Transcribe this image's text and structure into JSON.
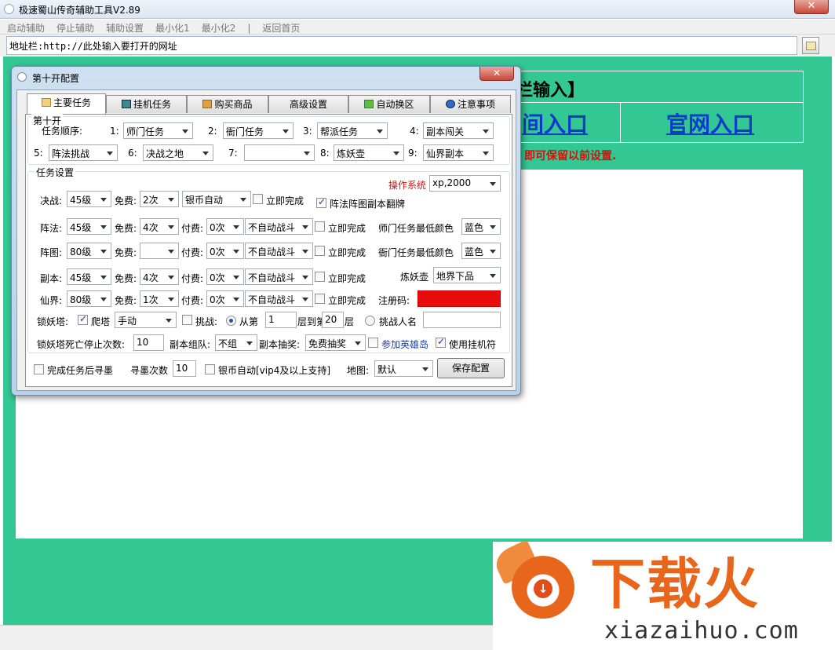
{
  "window": {
    "title": "极速蜀山传奇辅助工具V2.89",
    "close": "✕"
  },
  "menu": [
    "启动辅助",
    "停止辅助",
    "辅助设置",
    "最小化1",
    "最小化2",
    "|",
    "返回首页"
  ],
  "address": {
    "label": "地址栏:",
    "value": "http://此处输入要打开的网址"
  },
  "page": {
    "header_visible": "栏输入】",
    "link1": "间入口",
    "link2": "官网入口",
    "notice": "即可保留以前设置."
  },
  "watermark": {
    "text": "下载火",
    "url": "xiazaihuo.com"
  },
  "dialog": {
    "title": "第十开配置",
    "tabs": [
      "主要任务",
      "挂机任务",
      "购买商品",
      "高级设置",
      "自动换区",
      "注意事项"
    ],
    "group1": {
      "legend": "第十开",
      "order_label": "任务顺序:",
      "slots": [
        {
          "n": "1:",
          "v": "师门任务"
        },
        {
          "n": "2:",
          "v": "衙门任务"
        },
        {
          "n": "3:",
          "v": "帮派任务"
        },
        {
          "n": "4:",
          "v": "副本闯关"
        },
        {
          "n": "5:",
          "v": "阵法挑战"
        },
        {
          "n": "6:",
          "v": "决战之地"
        },
        {
          "n": "7:",
          "v": ""
        },
        {
          "n": "8:",
          "v": "炼妖壶"
        },
        {
          "n": "9:",
          "v": "仙界副本"
        }
      ]
    },
    "group2": {
      "legend": "任务设置",
      "os_label": "操作系统",
      "os_value": "xp,2000",
      "juezhan": {
        "label": "决战:",
        "level": "45级",
        "free_label": "免费:",
        "free": "2次",
        "mode": "银币自动",
        "instant": "立即完成"
      },
      "flip_label": "阵法阵图副本翻牌",
      "zhenfa": {
        "label": "阵法:",
        "level": "45级",
        "free_label": "免费:",
        "free": "4次",
        "paid_label": "付费:",
        "paid": "0次",
        "mode": "不自动战斗",
        "instant": "立即完成"
      },
      "zhentu": {
        "label": "阵图:",
        "level": "80级",
        "free_label": "免费:",
        "free": "",
        "paid_label": "付费:",
        "paid": "0次",
        "mode": "不自动战斗",
        "instant": "立即完成"
      },
      "fuben": {
        "label": "副本:",
        "level": "45级",
        "free_label": "免费:",
        "free": "4次",
        "paid_label": "付费:",
        "paid": "0次",
        "mode": "不自动战斗",
        "instant": "立即完成"
      },
      "xianjie": {
        "label": "仙界:",
        "level": "80级",
        "free_label": "免费:",
        "free": "1次",
        "paid_label": "付费:",
        "paid": "0次",
        "mode": "不自动战斗",
        "instant": "立即完成"
      },
      "shimen_color_label": "师门任务最低颜色",
      "shimen_color": "蓝色",
      "yamen_color_label": "衙门任务最低颜色",
      "yamen_color": "蓝色",
      "lianyao_label": "炼妖壶",
      "lianyao_value": "地界下品",
      "reg_label": "注册码:",
      "reg_color": "#e80c0c",
      "suoyao_label": "锁妖塔:",
      "climb_label": "爬塔",
      "climb_mode": "手动",
      "challenge_label": "挑战:",
      "from_label": "从第",
      "from_value": "1",
      "to_label": "层到第",
      "to_value": "20",
      "floor_label": "层",
      "challenge_name_label": "挑战人名",
      "challenge_name": "",
      "death_label": "锁妖塔死亡停止次数:",
      "death_value": "10",
      "team_label": "副本组队:",
      "team_value": "不组",
      "lottery_label": "副本抽奖:",
      "lottery_value": "免费抽奖",
      "hero_label": "参加英雄岛",
      "guaji_label": "使用挂机符"
    },
    "bottom": {
      "refind_label": "完成任务后寻墨",
      "refind_count_label": "寻墨次数",
      "refind_count": "10",
      "silver_label": "银币自动[vip4及以上支持]",
      "map_label": "地图:",
      "map_value": "默认",
      "save": "保存配置"
    }
  }
}
